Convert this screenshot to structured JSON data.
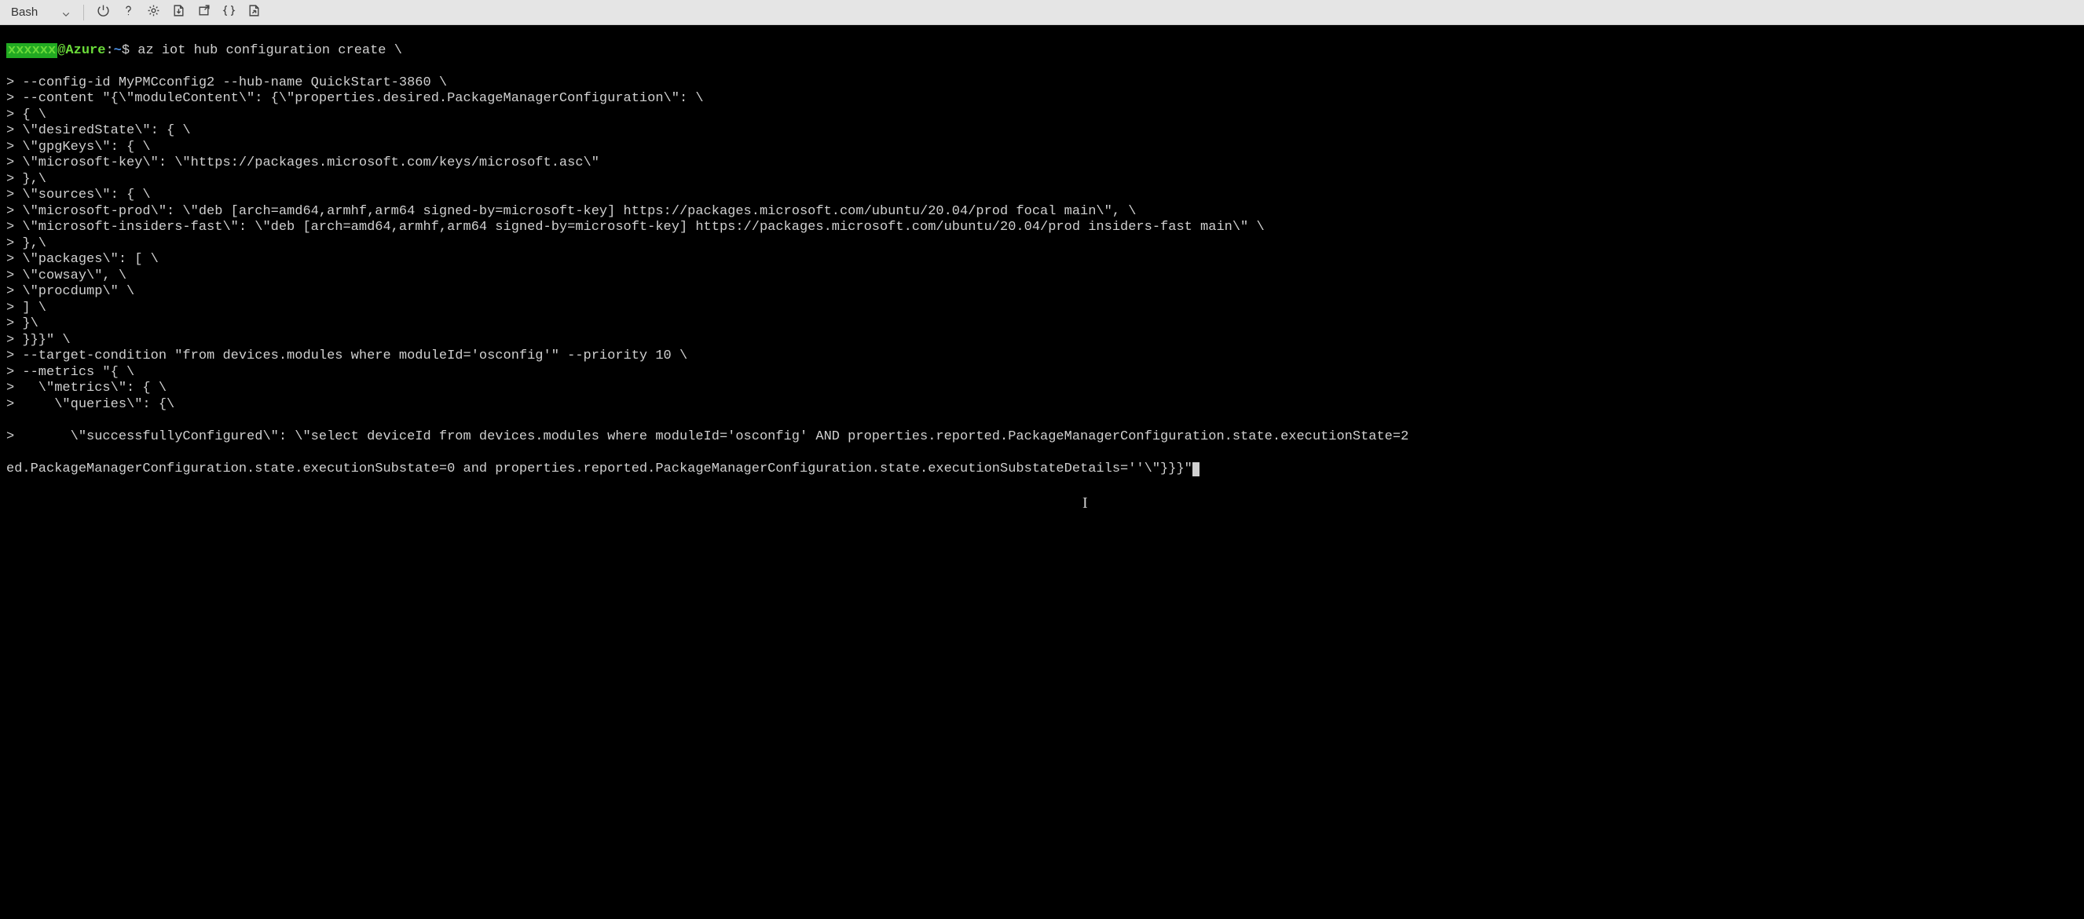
{
  "toolbar": {
    "shell_label": "Bash"
  },
  "terminal": {
    "prompt": {
      "user_masked": "xxxxxx",
      "at": "@",
      "host": "Azure",
      "colon": ":",
      "path": "~",
      "dollar": "$"
    },
    "first_cmd": " az iot hub configuration create \\",
    "lines": [
      "--config-id MyPMCconfig2 --hub-name QuickStart-3860 \\",
      "--content \"{\\\"moduleContent\\\": {\\\"properties.desired.PackageManagerConfiguration\\\": \\",
      "{ \\",
      "\\\"desiredState\\\": { \\",
      "\\\"gpgKeys\\\": { \\",
      "\\\"microsoft-key\\\": \\\"https://packages.microsoft.com/keys/microsoft.asc\\\"",
      "},\\",
      "\\\"sources\\\": { \\",
      "\\\"microsoft-prod\\\": \\\"deb [arch=amd64,armhf,arm64 signed-by=microsoft-key] https://packages.microsoft.com/ubuntu/20.04/prod focal main\\\", \\",
      "\\\"microsoft-insiders-fast\\\": \\\"deb [arch=amd64,armhf,arm64 signed-by=microsoft-key] https://packages.microsoft.com/ubuntu/20.04/prod insiders-fast main\\\" \\",
      "},\\",
      "\\\"packages\\\": [ \\",
      "\\\"cowsay\\\", \\",
      "\\\"procdump\\\" \\",
      "] \\",
      "}\\",
      "}}}\" \\",
      "--target-condition \"from devices.modules where moduleId='osconfig'\" --priority 10 \\",
      "--metrics \"{ \\",
      "  \\\"metrics\\\": { \\",
      "    \\\"queries\\\": {\\"
    ],
    "last_line_prefix": ">       \\\"successfullyConfigured\\\": \\\"select deviceId from devices.modules where moduleId='osconfig' AND properties.reported.PackageManagerConfiguration.state.executionState=2",
    "last_line_wrap": "ed.PackageManagerConfiguration.state.executionSubstate=0 and properties.reported.PackageManagerConfiguration.state.executionSubstateDetails=''\\\"}}}\""
  }
}
